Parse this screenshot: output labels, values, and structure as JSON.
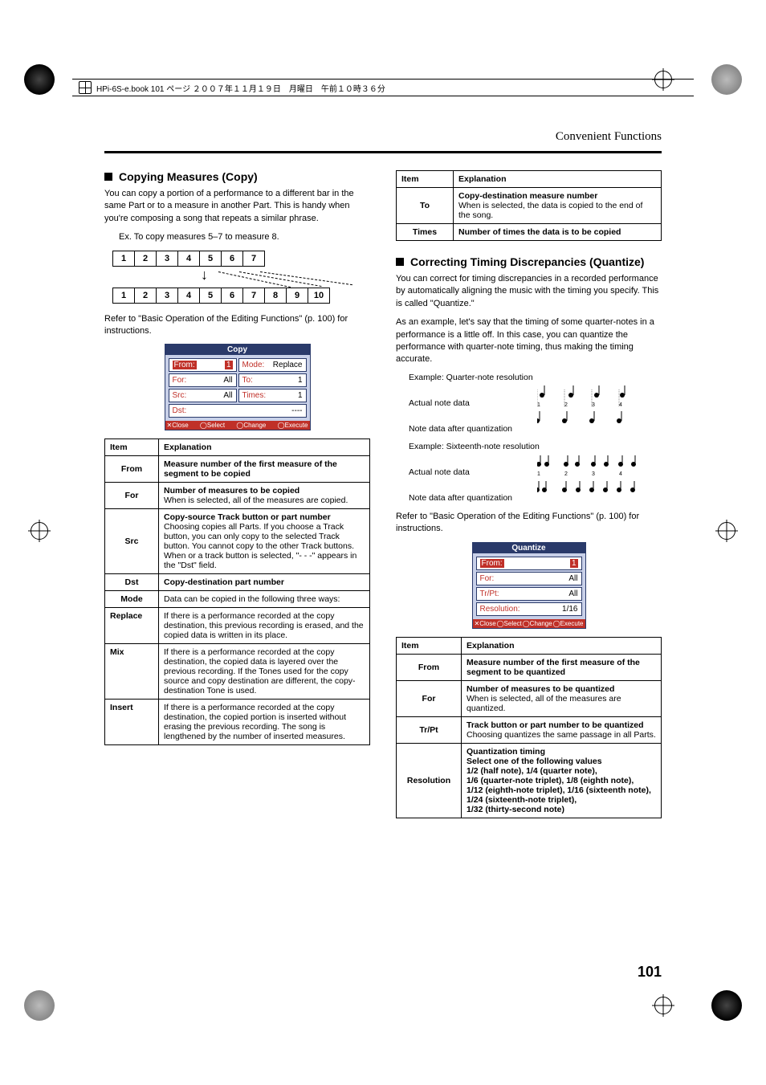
{
  "meta": {
    "header_text": "HPi-6S-e.book  101 ページ  ２００７年１１月１９日　月曜日　午前１０時３６分",
    "page_number": "101",
    "section_header": "Convenient Functions"
  },
  "left": {
    "title": "Copying Measures (Copy)",
    "p1": "You can copy a portion of a performance to a different bar in the same Part or to a measure in another Part. This is handy when you're composing a song that repeats a similar phrase.",
    "example_cap": "Ex. To copy measures 5–7 to measure 8.",
    "diagram_top": [
      "1",
      "2",
      "3",
      "4",
      "5",
      "6",
      "7"
    ],
    "diagram_bottom": [
      "1",
      "2",
      "3",
      "4",
      "5",
      "6",
      "7",
      "8",
      "9",
      "10"
    ],
    "ref": "Refer to \"Basic Operation of the Editing Functions\" (p. 100) for instructions.",
    "screenshot": {
      "title": "Copy",
      "rows": [
        [
          {
            "l": "From:",
            "v": "1",
            "sel": true
          },
          {
            "l": "Mode:",
            "v": "Replace"
          }
        ],
        [
          {
            "l": "For:",
            "v": "All"
          },
          {
            "l": "To:",
            "v": "1"
          }
        ],
        [
          {
            "l": "Src:",
            "v": "All"
          },
          {
            "l": "Times:",
            "v": "1"
          }
        ],
        [
          {
            "l": "Dst:",
            "v": "----"
          }
        ]
      ],
      "footer": [
        "✕Close",
        "◯Select",
        "◯Change",
        "◯Execute"
      ]
    },
    "table_head": [
      "Item",
      "Explanation"
    ],
    "table": [
      {
        "item": "From",
        "exp": "Measure number of the first measure of the segment to be copied",
        "bold": true
      },
      {
        "item": "For",
        "exp_bold": "Number of measures to be copied",
        "exp_rest": "When <All> is selected, all of the measures are copied."
      },
      {
        "item": "Src",
        "exp_bold": "Copy-source Track button or part number",
        "exp_rest": "Choosing <All> copies all Parts. If you choose a Track button, you can only copy to the selected Track button. You cannot copy to the other Track buttons. When <All> or a track button is selected, \"- - -\" appears in the \"Dst\" field."
      },
      {
        "item": "Dst",
        "exp": "Copy-destination part number",
        "bold": true
      }
    ],
    "mode_intro": "Data can be copied in the following three ways:",
    "mode_label": "Mode",
    "modes": [
      {
        "name": "Replace",
        "exp": "If there is a performance recorded at the copy destination, this previous recording is erased, and the copied data is written in its place."
      },
      {
        "name": "Mix",
        "exp": "If there is a performance recorded at the copy destination, the copied data is layered over the previous recording. If the Tones used for the copy source and copy destination are different, the copy-destination Tone is used."
      },
      {
        "name": "Insert",
        "exp": "If there is a performance recorded at the copy destination, the copied portion is inserted without erasing the previous recording. The song is lengthened by the number of inserted measures."
      }
    ]
  },
  "right_top": {
    "table_head": [
      "Item",
      "Explanation"
    ],
    "rows": [
      {
        "item": "To",
        "exp_bold": "Copy-destination measure number",
        "exp_rest": "When <End> is selected, the data is copied to the end of the song."
      },
      {
        "item": "Times",
        "exp": "Number of times the data is to be copied",
        "bold": true
      }
    ]
  },
  "quantize": {
    "title": "Correcting Timing Discrepancies (Quantize)",
    "p1": "You can correct for timing discrepancies in a recorded performance by automatically aligning the music with the timing you specify. This is called \"Quantize.\"",
    "p2": "As an example, let's say that the timing of some quarter-notes in a performance is a little off. In this case, you can quantize the performance with quarter-note timing, thus making the timing accurate.",
    "ex1_title": "Example: Quarter-note resolution",
    "ex2_title": "Example: Sixteenth-note resolution",
    "row_labels": {
      "actual": "Actual note data",
      "after": "Note data after quantization"
    },
    "beat_nums_q": [
      "1",
      "2",
      "3",
      "4"
    ],
    "ref": "Refer to \"Basic Operation of the Editing Functions\" (p. 100) for instructions.",
    "screenshot": {
      "title": "Quantize",
      "rows": [
        {
          "l": "From:",
          "v": "1",
          "sel": true
        },
        {
          "l": "For:",
          "v": "All"
        },
        {
          "l": "Tr/Pt:",
          "v": "All"
        },
        {
          "l": "Resolution:",
          "v": "1/16"
        }
      ],
      "footer": [
        "✕Close",
        "◯Select",
        "◯Change",
        "◯Execute"
      ]
    },
    "table_head": [
      "Item",
      "Explanation"
    ],
    "table": [
      {
        "item": "From",
        "exp": "Measure number of the first measure of the segment to be quantized",
        "bold": true
      },
      {
        "item": "For",
        "exp_bold": "Number of measures to be quantized",
        "exp_rest": "When <All> is selected, all of the measures are quantized."
      },
      {
        "item": "Tr/Pt",
        "exp_bold": "Track button or part number to be quantized",
        "exp_rest": "Choosing <All> quantizes the same passage in all Parts."
      },
      {
        "item": "Resolution",
        "exp_bold": "Quantization timing",
        "exp_rest": "Select one of the following values\n1/2 (half note), 1/4 (quarter note),\n1/6 (quarter-note triplet), 1/8 (eighth note),\n1/12 (eighth-note triplet), 1/16 (sixteenth note), 1/24 (sixteenth-note triplet),\n1/32 (thirty-second note)",
        "rest_bold": true
      }
    ]
  }
}
